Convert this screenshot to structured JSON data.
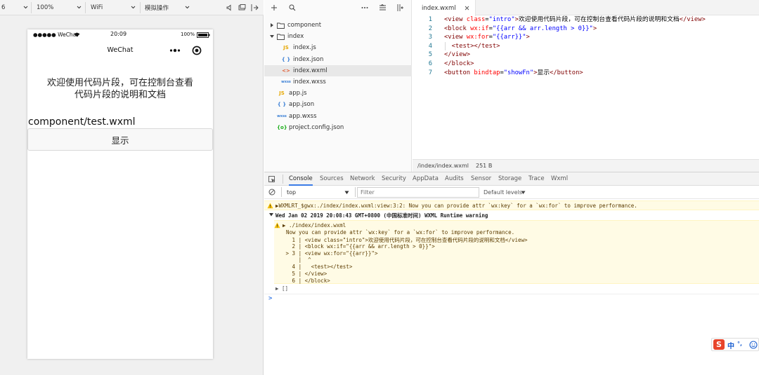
{
  "toolbar": {
    "device_partial": "6",
    "zoom": "100%",
    "network": "WiFi",
    "operation": "模拟操作"
  },
  "phone": {
    "carrier": "●●●●● WeChat",
    "time": "20:09",
    "battery": "100%",
    "nav_title": "WeChat",
    "intro_line1": "欢迎使用代码片段，可在控制台查看",
    "intro_line2": "代码片段的说明和文档",
    "component_text": "component/test.wxml",
    "button_label": "显示"
  },
  "file_tree": {
    "items": [
      {
        "name": "component",
        "type": "folder",
        "expanded": false
      },
      {
        "name": "index",
        "type": "folder",
        "expanded": true
      },
      {
        "name": "index.js",
        "type": "js",
        "icon": "JS"
      },
      {
        "name": "index.json",
        "type": "json",
        "icon": "{ }"
      },
      {
        "name": "index.wxml",
        "type": "wxml",
        "icon": "<>"
      },
      {
        "name": "index.wxss",
        "type": "wxss",
        "icon": "wxss"
      },
      {
        "name": "app.js",
        "type": "js",
        "icon": "JS"
      },
      {
        "name": "app.json",
        "type": "json",
        "icon": "{ }"
      },
      {
        "name": "app.wxss",
        "type": "wxss",
        "icon": "wxss"
      },
      {
        "name": "project.config.json",
        "type": "config",
        "icon": "{o}"
      }
    ],
    "selected": "index.wxml"
  },
  "editor": {
    "tab_title": "index.wxml",
    "lines": [
      {
        "n": "1",
        "segs": [
          [
            "tg",
            "<view "
          ],
          [
            "at",
            "class"
          ],
          [
            "tx",
            "="
          ],
          [
            "av",
            "\"intro\""
          ],
          [
            "tg",
            ">"
          ],
          [
            "tx",
            "欢迎使用代码片段，可在控制台查看代码片段的说明和文档"
          ],
          [
            "tg",
            "</view>"
          ]
        ]
      },
      {
        "n": "2",
        "segs": [
          [
            "tg",
            "<block "
          ],
          [
            "at",
            "wx:if"
          ],
          [
            "tx",
            "="
          ],
          [
            "av",
            "\"{{arr && arr.length > 0}}\""
          ],
          [
            "tg",
            ">"
          ]
        ]
      },
      {
        "n": "3",
        "segs": [
          [
            "tg",
            "<view "
          ],
          [
            "at",
            "wx:for"
          ],
          [
            "tx",
            "="
          ],
          [
            "av",
            "\"{{arr}}\""
          ],
          [
            "tg",
            ">"
          ]
        ]
      },
      {
        "n": "4",
        "segs": [
          [
            "tx",
            "  "
          ],
          [
            "tg",
            "<test></test>"
          ]
        ]
      },
      {
        "n": "5",
        "segs": [
          [
            "tg",
            "</view>"
          ]
        ]
      },
      {
        "n": "6",
        "segs": [
          [
            "tg",
            "</block>"
          ]
        ]
      },
      {
        "n": "7",
        "segs": [
          [
            "tg",
            "<button "
          ],
          [
            "at",
            "bindtap"
          ],
          [
            "tx",
            "="
          ],
          [
            "av",
            "\"showFn\""
          ],
          [
            "tg",
            ">"
          ],
          [
            "tx",
            "显示"
          ],
          [
            "tg",
            "</button>"
          ]
        ]
      }
    ],
    "status_path": "/index/index.wxml",
    "status_size": "251 B"
  },
  "console": {
    "tabs": [
      "Console",
      "Sources",
      "Network",
      "Security",
      "AppData",
      "Audits",
      "Sensor",
      "Storage",
      "Trace",
      "Wxml"
    ],
    "active_tab": "Console",
    "context": "top",
    "filter_placeholder": "Filter",
    "levels": "Default levels",
    "warn1": "▶WXMLRT_$gwx:./index/index.wxml:view:3:2: Now you can provide attr `wx:key` for a `wx:for` to improve performance.",
    "warn2_header": "Wed Jan 02 2019 20:08:43 GMT+0800 (中国标准时间) WXML Runtime warning",
    "warn2_file": "▶ ./index/index.wxml",
    "warn2_msg": "Now you can provide attr `wx:key` for a `wx:for` to improve performance.",
    "snippet": [
      "   1 | <view class=\"intro\">欢迎使用代码片段，可在控制台查看代码片段的说明和文档</view>",
      "   2 | <block wx:if=\"{{arr && arr.length > 0}}\">",
      " > 3 | <view wx:for=\"{{arr}}\">",
      "     |  ^",
      "   4 |   <test></test>",
      "   5 | </view>",
      "   6 | </block>"
    ],
    "array_line": "▶ []",
    "prompt": ">"
  },
  "ime": {
    "label": "中",
    "punct": "°,"
  },
  "colors": {
    "accent": "#1aad19",
    "warn_bg": "#fffbe5",
    "warn_text": "#5c3c00",
    "ime_red": "#e8452c"
  }
}
